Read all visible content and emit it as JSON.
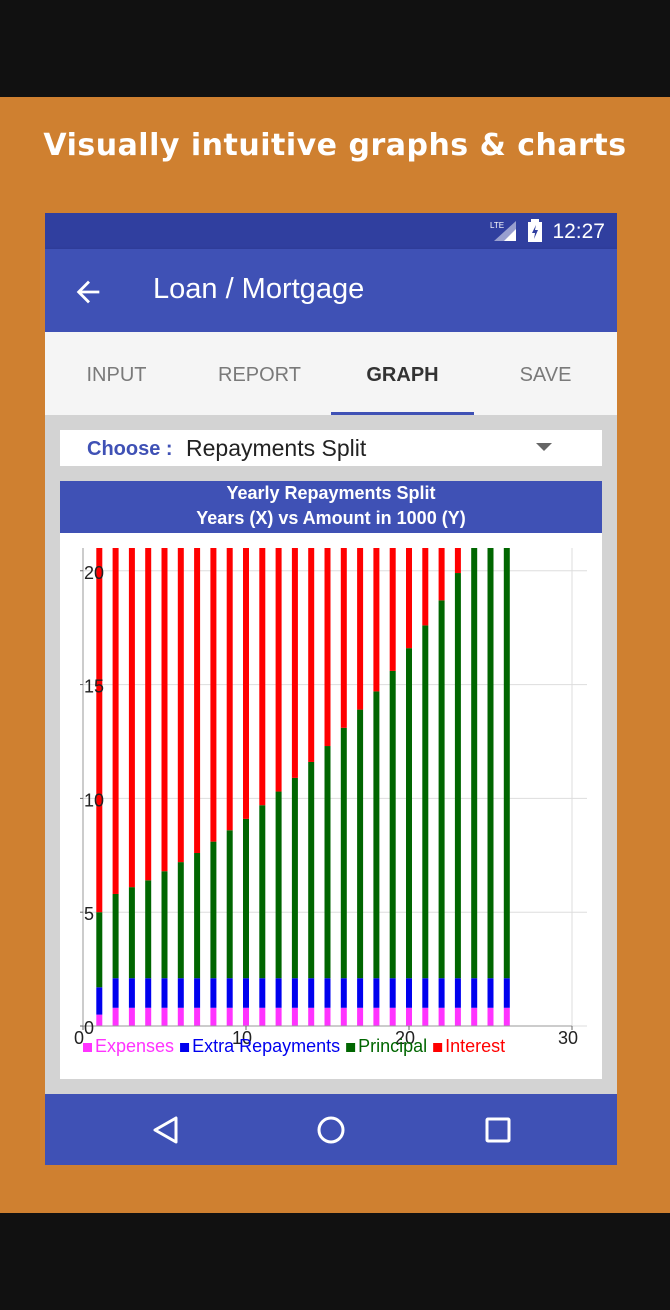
{
  "promo": {
    "headline": "Visually intuitive graphs & charts"
  },
  "status_bar": {
    "network": "LTE",
    "time": "12:27"
  },
  "app_bar": {
    "title": "Loan / Mortgage",
    "back_icon": "arrow-left-icon"
  },
  "tabs": [
    {
      "label": "INPUT",
      "active": false
    },
    {
      "label": "REPORT",
      "active": false
    },
    {
      "label": "GRAPH",
      "active": true
    },
    {
      "label": "SAVE",
      "active": false
    }
  ],
  "chooser": {
    "label": "Choose :",
    "value": "Repayments Split"
  },
  "chart_header": {
    "line1": "Yearly Repayments Split",
    "line2": "Years (X)  vs  Amount in 1000 (Y)"
  },
  "chart_data": {
    "type": "bar",
    "stacked": true,
    "title": "Yearly Repayments Split",
    "subtitle": "Years (X)  vs  Amount in 1000 (Y)",
    "x": [
      1,
      2,
      3,
      4,
      5,
      6,
      7,
      8,
      9,
      10,
      11,
      12,
      13,
      14,
      15,
      16,
      17,
      18,
      19,
      20,
      21,
      22,
      23,
      24,
      25,
      26
    ],
    "xlim": [
      0,
      30
    ],
    "ylim": [
      0,
      21
    ],
    "x_ticks": [
      0,
      10,
      20,
      30
    ],
    "y_ticks": [
      0,
      5,
      10,
      15,
      20
    ],
    "grid": true,
    "legend_position": "bottom",
    "series": [
      {
        "name": "Expenses",
        "color": "#ff33ff",
        "values": [
          0.5,
          0.8,
          0.8,
          0.8,
          0.8,
          0.8,
          0.8,
          0.8,
          0.8,
          0.8,
          0.8,
          0.8,
          0.8,
          0.8,
          0.8,
          0.8,
          0.8,
          0.8,
          0.8,
          0.8,
          0.8,
          0.8,
          0.8,
          0.8,
          0.8,
          0.8
        ]
      },
      {
        "name": "Extra Repayments",
        "color": "#0000ee",
        "values": [
          1.2,
          1.3,
          1.3,
          1.3,
          1.3,
          1.3,
          1.3,
          1.3,
          1.3,
          1.3,
          1.3,
          1.3,
          1.3,
          1.3,
          1.3,
          1.3,
          1.3,
          1.3,
          1.3,
          1.3,
          1.3,
          1.3,
          1.3,
          1.3,
          1.3,
          1.3
        ]
      },
      {
        "name": "Principal",
        "color": "#006600",
        "values": [
          3.3,
          3.7,
          4.0,
          4.3,
          4.7,
          5.1,
          5.5,
          6.0,
          6.5,
          7.0,
          7.6,
          8.2,
          8.8,
          9.5,
          10.2,
          11.0,
          11.8,
          12.6,
          13.5,
          14.5,
          15.5,
          16.6,
          17.8,
          18.9,
          18.9,
          18.9
        ]
      },
      {
        "name": "Interest",
        "color": "#ff0000",
        "values": [
          16.0,
          15.2,
          14.9,
          14.6,
          14.2,
          13.8,
          13.4,
          12.9,
          12.4,
          11.9,
          11.3,
          10.7,
          10.1,
          9.4,
          8.7,
          7.9,
          7.1,
          6.3,
          5.4,
          4.4,
          3.4,
          2.3,
          1.1,
          0,
          0,
          0
        ]
      }
    ]
  },
  "nav_bar": {
    "icons": [
      "back-triangle-icon",
      "home-circle-icon",
      "recents-square-icon"
    ]
  }
}
